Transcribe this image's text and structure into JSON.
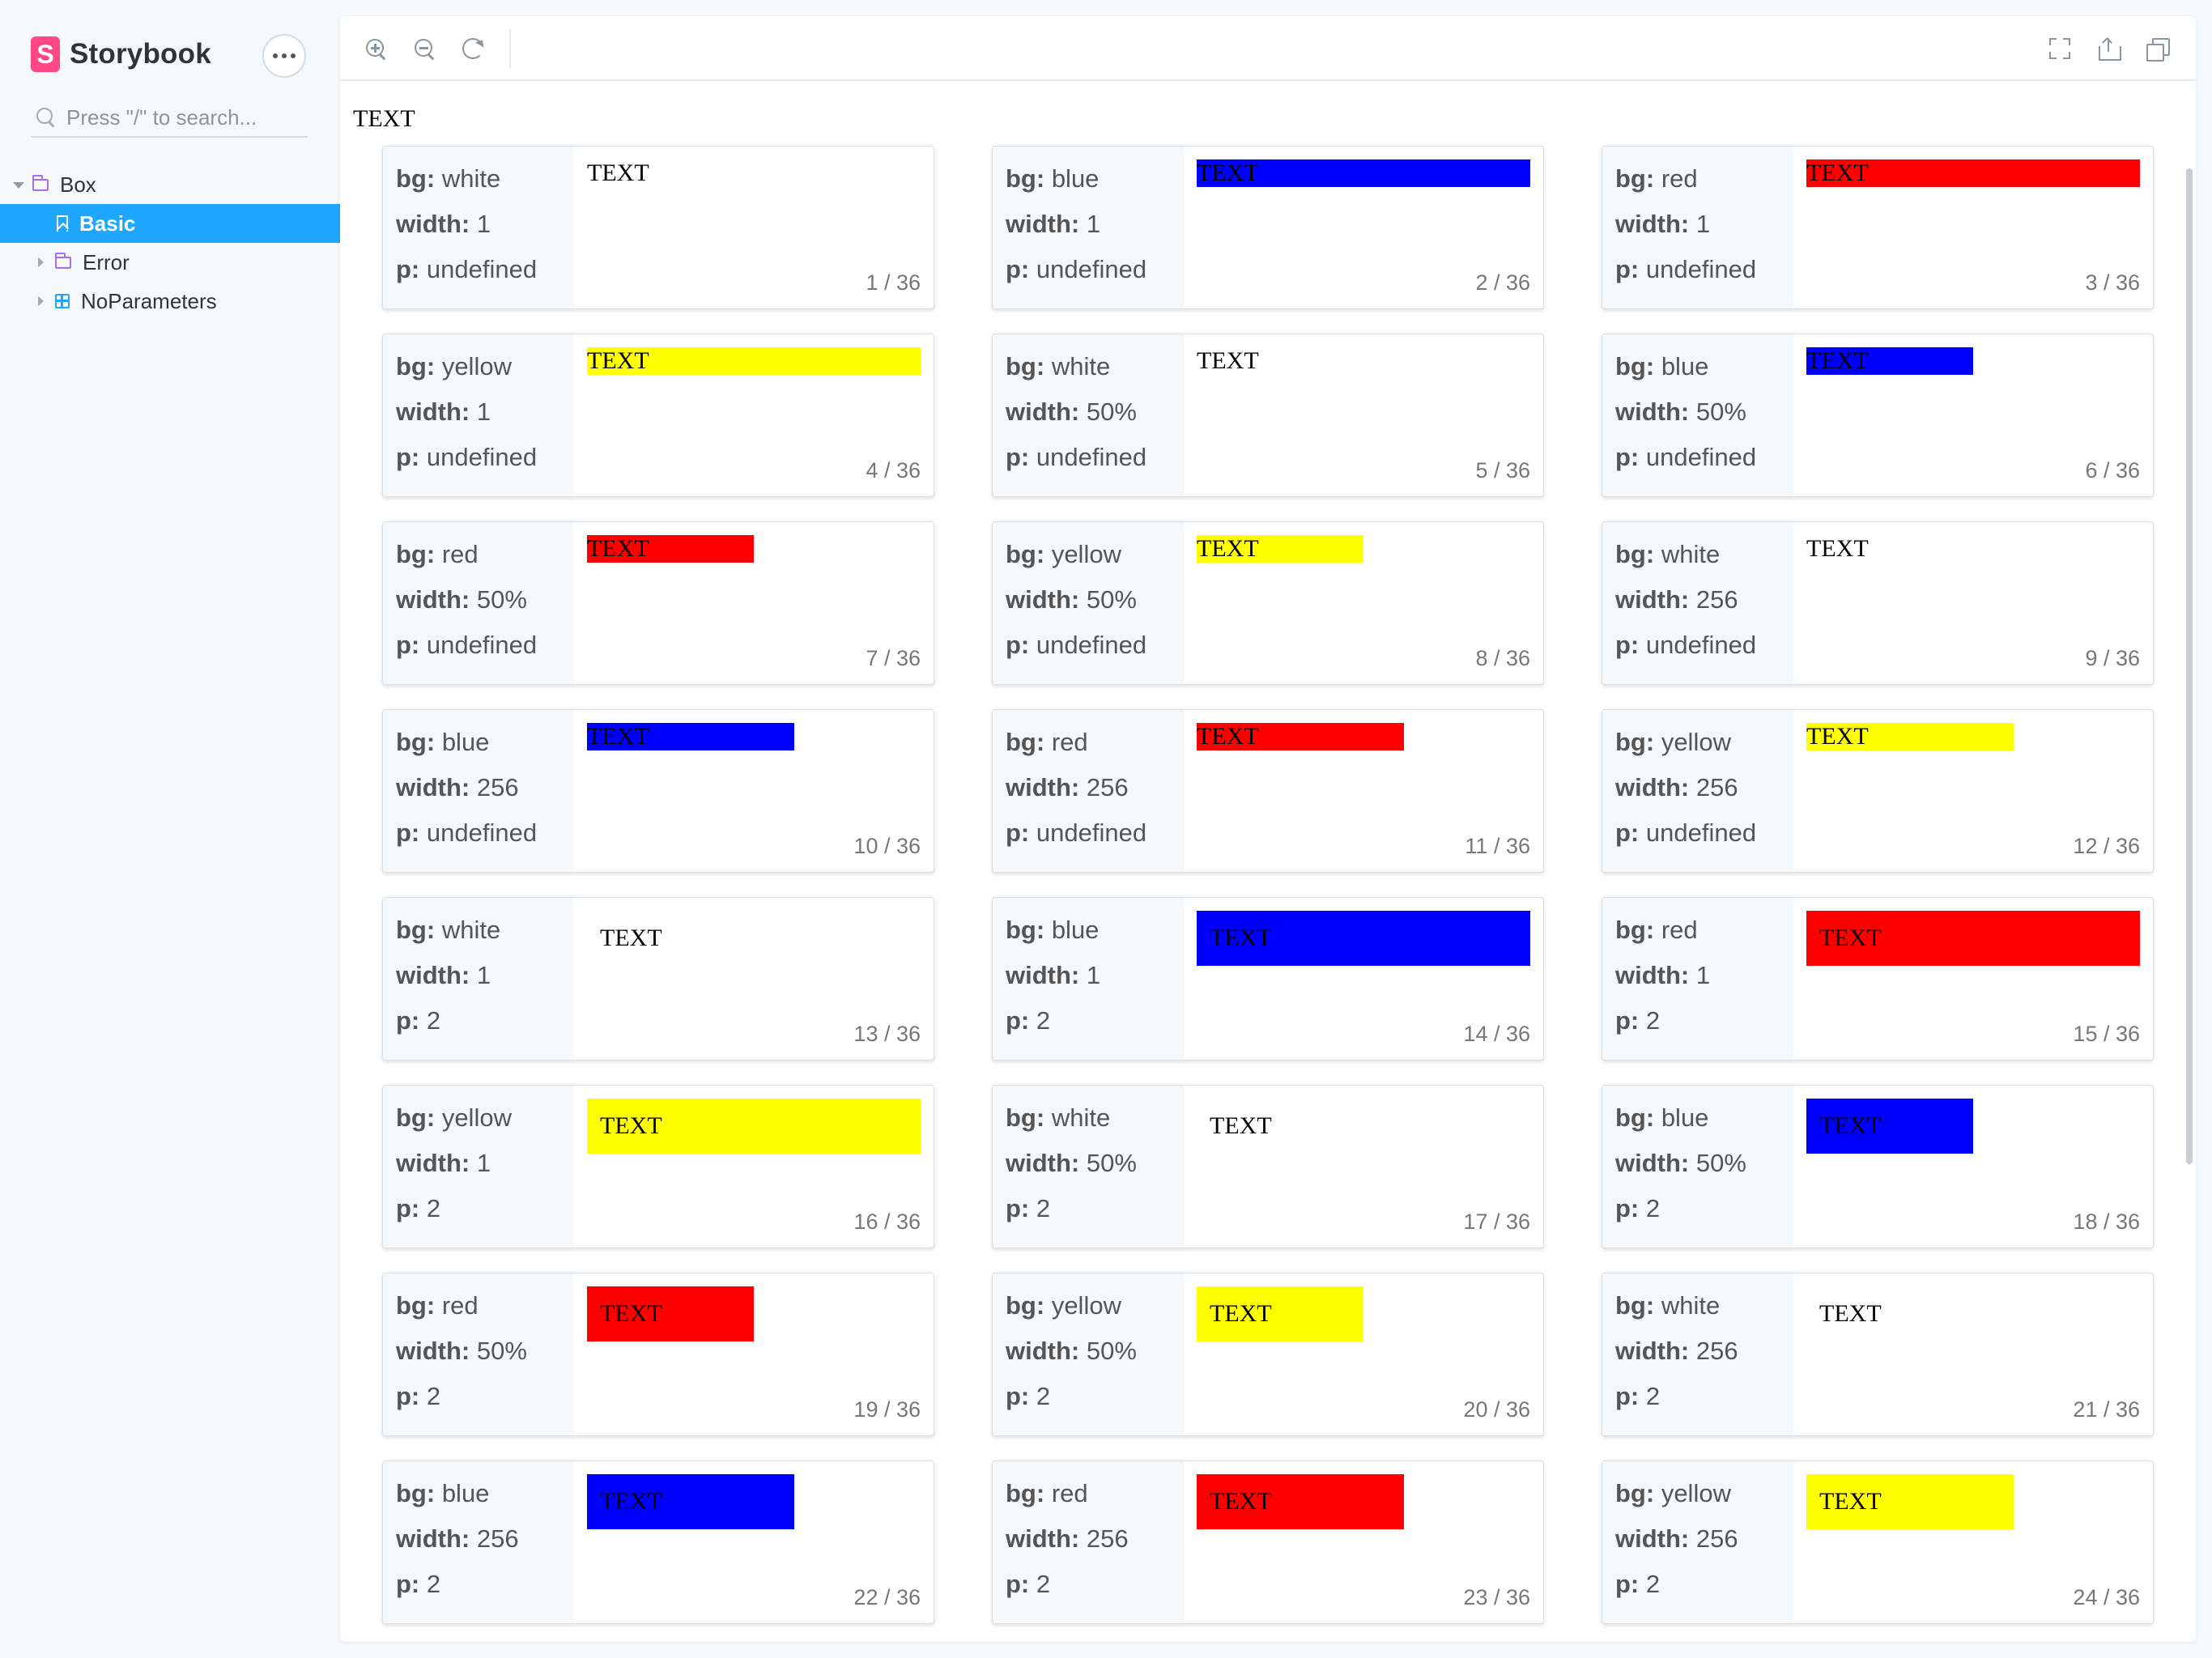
{
  "app": {
    "name": "Storybook",
    "logo_letter": "S"
  },
  "search": {
    "placeholder": "Press \"/\" to search..."
  },
  "tree": [
    {
      "label": "Box",
      "type": "folder",
      "expanded": true
    },
    {
      "label": "Basic",
      "type": "story",
      "active": true
    },
    {
      "label": "Error",
      "type": "folder"
    },
    {
      "label": "NoParameters",
      "type": "component"
    }
  ],
  "toolbar": {
    "left": [
      "zoom-in-icon",
      "zoom-out-icon",
      "reset-zoom-icon"
    ],
    "right": [
      "fullscreen-icon",
      "share-icon",
      "copy-icon"
    ]
  },
  "canvas": {
    "title": "TEXT"
  },
  "colors": {
    "white": "#ffffff",
    "blue": "#0000ff",
    "red": "#ff0000",
    "yellow": "#ffff00",
    "accent": "#1ea7fd",
    "brand": "#ff4785"
  },
  "cards": [
    {
      "bg": "white",
      "width": "1",
      "p": "undefined",
      "text": "TEXT",
      "counter": "1 / 36"
    },
    {
      "bg": "blue",
      "width": "1",
      "p": "undefined",
      "text": "TEXT",
      "counter": "2 / 36"
    },
    {
      "bg": "red",
      "width": "1",
      "p": "undefined",
      "text": "TEXT",
      "counter": "3 / 36"
    },
    {
      "bg": "yellow",
      "width": "1",
      "p": "undefined",
      "text": "TEXT",
      "counter": "4 / 36"
    },
    {
      "bg": "white",
      "width": "50%",
      "p": "undefined",
      "text": "TEXT",
      "counter": "5 / 36"
    },
    {
      "bg": "blue",
      "width": "50%",
      "p": "undefined",
      "text": "TEXT",
      "counter": "6 / 36"
    },
    {
      "bg": "red",
      "width": "50%",
      "p": "undefined",
      "text": "TEXT",
      "counter": "7 / 36"
    },
    {
      "bg": "yellow",
      "width": "50%",
      "p": "undefined",
      "text": "TEXT",
      "counter": "8 / 36"
    },
    {
      "bg": "white",
      "width": "256",
      "p": "undefined",
      "text": "TEXT",
      "counter": "9 / 36"
    },
    {
      "bg": "blue",
      "width": "256",
      "p": "undefined",
      "text": "TEXT",
      "counter": "10 / 36"
    },
    {
      "bg": "red",
      "width": "256",
      "p": "undefined",
      "text": "TEXT",
      "counter": "11 / 36"
    },
    {
      "bg": "yellow",
      "width": "256",
      "p": "undefined",
      "text": "TEXT",
      "counter": "12 / 36"
    },
    {
      "bg": "white",
      "width": "1",
      "p": "2",
      "text": "TEXT",
      "counter": "13 / 36"
    },
    {
      "bg": "blue",
      "width": "1",
      "p": "2",
      "text": "TEXT",
      "counter": "14 / 36"
    },
    {
      "bg": "red",
      "width": "1",
      "p": "2",
      "text": "TEXT",
      "counter": "15 / 36"
    },
    {
      "bg": "yellow",
      "width": "1",
      "p": "2",
      "text": "TEXT",
      "counter": "16 / 36"
    },
    {
      "bg": "white",
      "width": "50%",
      "p": "2",
      "text": "TEXT",
      "counter": "17 / 36"
    },
    {
      "bg": "blue",
      "width": "50%",
      "p": "2",
      "text": "TEXT",
      "counter": "18 / 36"
    },
    {
      "bg": "red",
      "width": "50%",
      "p": "2",
      "text": "TEXT",
      "counter": "19 / 36"
    },
    {
      "bg": "yellow",
      "width": "50%",
      "p": "2",
      "text": "TEXT",
      "counter": "20 / 36"
    },
    {
      "bg": "white",
      "width": "256",
      "p": "2",
      "text": "TEXT",
      "counter": "21 / 36"
    },
    {
      "bg": "blue",
      "width": "256",
      "p": "2",
      "text": "TEXT",
      "counter": "22 / 36"
    },
    {
      "bg": "red",
      "width": "256",
      "p": "2",
      "text": "TEXT",
      "counter": "23 / 36"
    },
    {
      "bg": "yellow",
      "width": "256",
      "p": "2",
      "text": "TEXT",
      "counter": "24 / 36"
    }
  ]
}
